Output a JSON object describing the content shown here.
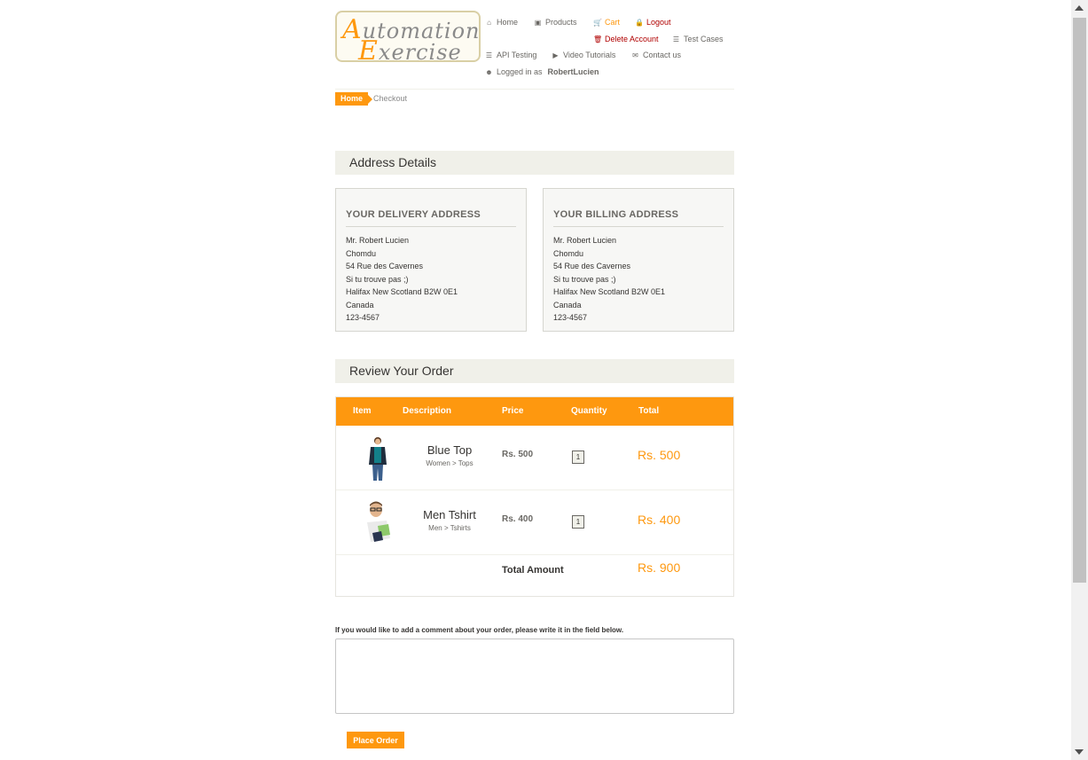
{
  "logo": {
    "line1_first": "A",
    "line1_rest": "utomation",
    "line2_first": "E",
    "line2_rest": "xercise"
  },
  "nav": {
    "home": "Home",
    "products": "Products",
    "cart": "Cart",
    "logout": "Logout",
    "delete_account": "Delete Account",
    "test_cases": "Test Cases",
    "api_testing": "API Testing",
    "video_tutorials": "Video Tutorials",
    "contact_us": "Contact us",
    "logged_in_prefix": "Logged in as",
    "username": "RobertLucien"
  },
  "breadcrumb": {
    "home": "Home",
    "current": "Checkout"
  },
  "address_section": {
    "title": "Address Details"
  },
  "delivery": {
    "title": "YOUR DELIVERY ADDRESS",
    "lines": [
      "Mr. Robert Lucien",
      "Chomdu",
      "54 Rue des Cavernes",
      "Si tu trouve pas ;)",
      "Halifax New Scotland B2W 0E1",
      "Canada",
      "123-4567"
    ]
  },
  "billing": {
    "title": "YOUR BILLING ADDRESS",
    "lines": [
      "Mr. Robert Lucien",
      "Chomdu",
      "54 Rue des Cavernes",
      "Si tu trouve pas ;)",
      "Halifax New Scotland B2W 0E1",
      "Canada",
      "123-4567"
    ]
  },
  "review_section": {
    "title": "Review Your Order"
  },
  "table": {
    "headers": {
      "item": "Item",
      "description": "Description",
      "price": "Price",
      "quantity": "Quantity",
      "total": "Total"
    },
    "rows": [
      {
        "name": "Blue Top",
        "category": "Women > Tops",
        "price": "Rs. 500",
        "quantity": "1",
        "total": "Rs. 500"
      },
      {
        "name": "Men Tshirt",
        "category": "Men > Tshirts",
        "price": "Rs. 400",
        "quantity": "1",
        "total": "Rs. 400"
      }
    ],
    "total_label": "Total Amount",
    "total_amount": "Rs. 900"
  },
  "comment": {
    "label": "If you would like to add a comment about your order, please write it in the field below.",
    "value": ""
  },
  "place_order": "Place Order",
  "colors": {
    "accent": "#fe980f",
    "section_bg": "#f0f0e9",
    "danger": "#b00000"
  }
}
